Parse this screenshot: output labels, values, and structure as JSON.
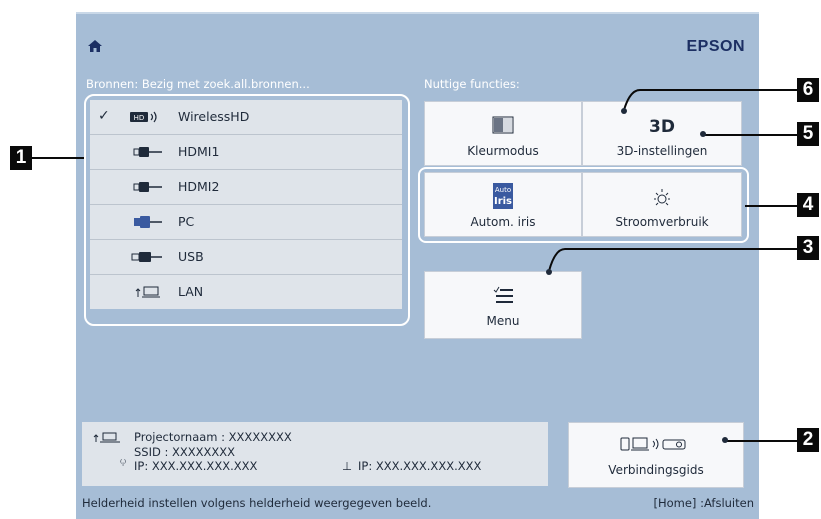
{
  "header": {
    "brand": "EPSON",
    "home_icon": "home-icon"
  },
  "sources": {
    "heading": "Bronnen: Bezig met zoek.all.bronnen...",
    "items": [
      {
        "label": "WirelessHD",
        "icon": "wirelesshd-icon",
        "checked": true
      },
      {
        "label": "HDMI1",
        "icon": "hdmi-icon"
      },
      {
        "label": "HDMI2",
        "icon": "hdmi-icon"
      },
      {
        "label": "PC",
        "icon": "pc-icon"
      },
      {
        "label": "USB",
        "icon": "usb-icon"
      },
      {
        "label": "LAN",
        "icon": "lan-icon"
      }
    ]
  },
  "functions": {
    "heading": "Nuttige functies:",
    "color_mode": "Kleurmodus",
    "three_d": "3D-instellingen",
    "auto_iris": "Autom. iris",
    "power": "Stroomverbruik",
    "menu": "Menu",
    "guide": "Verbindingsgids",
    "iris_icon_top": "Auto",
    "iris_icon_bottom": "Iris",
    "three_d_icon_text": "3D"
  },
  "info": {
    "projector_name": "Projectornaam : XXXXXXXX",
    "ssid": "SSID : XXXXXXXX",
    "ip_wireless": "IP: XXX.XXX.XXX.XXX",
    "ip_wired": "IP: XXX.XXX.XXX.XXX"
  },
  "status": {
    "left": "Helderheid instellen volgens helderheid weergegeven beeld.",
    "right": "[Home] :Afsluiten"
  },
  "callouts": [
    "1",
    "2",
    "3",
    "4",
    "5",
    "6"
  ],
  "colors": {
    "background": "#a6bdd6",
    "panel": "#dfe4ea",
    "button": "#f7f8fa",
    "text": "#1f2a3a",
    "brand": "#1c2f63"
  }
}
